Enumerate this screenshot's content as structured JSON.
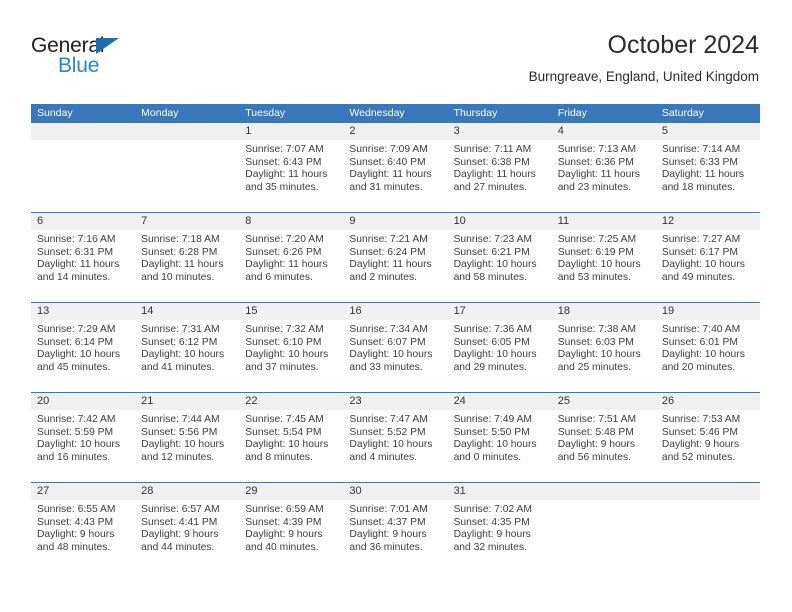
{
  "brand": {
    "name_top": "General",
    "name_bottom": "Blue",
    "accent_color": "#2389d4",
    "triangle_color": "#1f6cb0"
  },
  "header": {
    "title": "October 2024",
    "subtitle": "Burngreave, England, United Kingdom"
  },
  "theme": {
    "header_blue": "#3a78bc",
    "daynum_band": "#f0f0f0",
    "text": "#3d3d3d"
  },
  "weekdays": [
    "Sunday",
    "Monday",
    "Tuesday",
    "Wednesday",
    "Thursday",
    "Friday",
    "Saturday"
  ],
  "weeks": [
    [
      {
        "day": "",
        "lines": []
      },
      {
        "day": "",
        "lines": []
      },
      {
        "day": "1",
        "lines": [
          "Sunrise: 7:07 AM",
          "Sunset: 6:43 PM",
          "Daylight: 11 hours",
          "and 35 minutes."
        ]
      },
      {
        "day": "2",
        "lines": [
          "Sunrise: 7:09 AM",
          "Sunset: 6:40 PM",
          "Daylight: 11 hours",
          "and 31 minutes."
        ]
      },
      {
        "day": "3",
        "lines": [
          "Sunrise: 7:11 AM",
          "Sunset: 6:38 PM",
          "Daylight: 11 hours",
          "and 27 minutes."
        ]
      },
      {
        "day": "4",
        "lines": [
          "Sunrise: 7:13 AM",
          "Sunset: 6:36 PM",
          "Daylight: 11 hours",
          "and 23 minutes."
        ]
      },
      {
        "day": "5",
        "lines": [
          "Sunrise: 7:14 AM",
          "Sunset: 6:33 PM",
          "Daylight: 11 hours",
          "and 18 minutes."
        ]
      }
    ],
    [
      {
        "day": "6",
        "lines": [
          "Sunrise: 7:16 AM",
          "Sunset: 6:31 PM",
          "Daylight: 11 hours",
          "and 14 minutes."
        ]
      },
      {
        "day": "7",
        "lines": [
          "Sunrise: 7:18 AM",
          "Sunset: 6:28 PM",
          "Daylight: 11 hours",
          "and 10 minutes."
        ]
      },
      {
        "day": "8",
        "lines": [
          "Sunrise: 7:20 AM",
          "Sunset: 6:26 PM",
          "Daylight: 11 hours",
          "and 6 minutes."
        ]
      },
      {
        "day": "9",
        "lines": [
          "Sunrise: 7:21 AM",
          "Sunset: 6:24 PM",
          "Daylight: 11 hours",
          "and 2 minutes."
        ]
      },
      {
        "day": "10",
        "lines": [
          "Sunrise: 7:23 AM",
          "Sunset: 6:21 PM",
          "Daylight: 10 hours",
          "and 58 minutes."
        ]
      },
      {
        "day": "11",
        "lines": [
          "Sunrise: 7:25 AM",
          "Sunset: 6:19 PM",
          "Daylight: 10 hours",
          "and 53 minutes."
        ]
      },
      {
        "day": "12",
        "lines": [
          "Sunrise: 7:27 AM",
          "Sunset: 6:17 PM",
          "Daylight: 10 hours",
          "and 49 minutes."
        ]
      }
    ],
    [
      {
        "day": "13",
        "lines": [
          "Sunrise: 7:29 AM",
          "Sunset: 6:14 PM",
          "Daylight: 10 hours",
          "and 45 minutes."
        ]
      },
      {
        "day": "14",
        "lines": [
          "Sunrise: 7:31 AM",
          "Sunset: 6:12 PM",
          "Daylight: 10 hours",
          "and 41 minutes."
        ]
      },
      {
        "day": "15",
        "lines": [
          "Sunrise: 7:32 AM",
          "Sunset: 6:10 PM",
          "Daylight: 10 hours",
          "and 37 minutes."
        ]
      },
      {
        "day": "16",
        "lines": [
          "Sunrise: 7:34 AM",
          "Sunset: 6:07 PM",
          "Daylight: 10 hours",
          "and 33 minutes."
        ]
      },
      {
        "day": "17",
        "lines": [
          "Sunrise: 7:36 AM",
          "Sunset: 6:05 PM",
          "Daylight: 10 hours",
          "and 29 minutes."
        ]
      },
      {
        "day": "18",
        "lines": [
          "Sunrise: 7:38 AM",
          "Sunset: 6:03 PM",
          "Daylight: 10 hours",
          "and 25 minutes."
        ]
      },
      {
        "day": "19",
        "lines": [
          "Sunrise: 7:40 AM",
          "Sunset: 6:01 PM",
          "Daylight: 10 hours",
          "and 20 minutes."
        ]
      }
    ],
    [
      {
        "day": "20",
        "lines": [
          "Sunrise: 7:42 AM",
          "Sunset: 5:59 PM",
          "Daylight: 10 hours",
          "and 16 minutes."
        ]
      },
      {
        "day": "21",
        "lines": [
          "Sunrise: 7:44 AM",
          "Sunset: 5:56 PM",
          "Daylight: 10 hours",
          "and 12 minutes."
        ]
      },
      {
        "day": "22",
        "lines": [
          "Sunrise: 7:45 AM",
          "Sunset: 5:54 PM",
          "Daylight: 10 hours",
          "and 8 minutes."
        ]
      },
      {
        "day": "23",
        "lines": [
          "Sunrise: 7:47 AM",
          "Sunset: 5:52 PM",
          "Daylight: 10 hours",
          "and 4 minutes."
        ]
      },
      {
        "day": "24",
        "lines": [
          "Sunrise: 7:49 AM",
          "Sunset: 5:50 PM",
          "Daylight: 10 hours",
          "and 0 minutes."
        ]
      },
      {
        "day": "25",
        "lines": [
          "Sunrise: 7:51 AM",
          "Sunset: 5:48 PM",
          "Daylight: 9 hours",
          "and 56 minutes."
        ]
      },
      {
        "day": "26",
        "lines": [
          "Sunrise: 7:53 AM",
          "Sunset: 5:46 PM",
          "Daylight: 9 hours",
          "and 52 minutes."
        ]
      }
    ],
    [
      {
        "day": "27",
        "lines": [
          "Sunrise: 6:55 AM",
          "Sunset: 4:43 PM",
          "Daylight: 9 hours",
          "and 48 minutes."
        ]
      },
      {
        "day": "28",
        "lines": [
          "Sunrise: 6:57 AM",
          "Sunset: 4:41 PM",
          "Daylight: 9 hours",
          "and 44 minutes."
        ]
      },
      {
        "day": "29",
        "lines": [
          "Sunrise: 6:59 AM",
          "Sunset: 4:39 PM",
          "Daylight: 9 hours",
          "and 40 minutes."
        ]
      },
      {
        "day": "30",
        "lines": [
          "Sunrise: 7:01 AM",
          "Sunset: 4:37 PM",
          "Daylight: 9 hours",
          "and 36 minutes."
        ]
      },
      {
        "day": "31",
        "lines": [
          "Sunrise: 7:02 AM",
          "Sunset: 4:35 PM",
          "Daylight: 9 hours",
          "and 32 minutes."
        ]
      },
      {
        "day": "",
        "lines": []
      },
      {
        "day": "",
        "lines": []
      }
    ]
  ]
}
